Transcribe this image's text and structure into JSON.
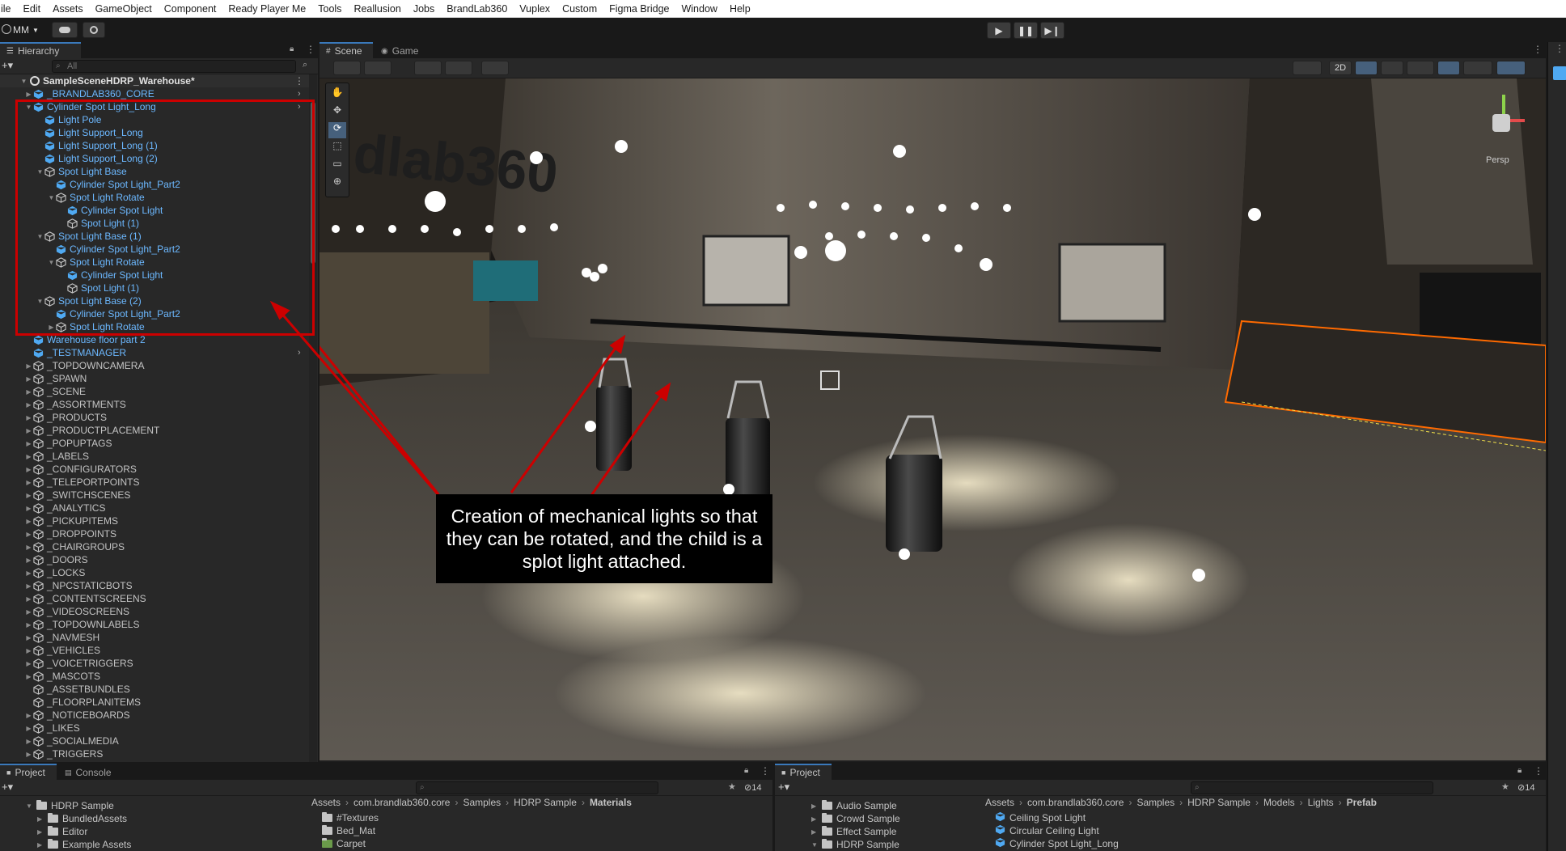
{
  "menu": [
    "ile",
    "Edit",
    "Assets",
    "GameObject",
    "Component",
    "Ready Player Me",
    "Tools",
    "Reallusion",
    "Jobs",
    "BrandLab360",
    "Vuplex",
    "Custom",
    "Figma Bridge",
    "Window",
    "Help"
  ],
  "toolbar": {
    "account": "MM"
  },
  "hierarchy": {
    "tab": "Hierarchy",
    "search_placeholder": "All",
    "scene": "SampleSceneHDRP_Warehouse*",
    "rows": [
      {
        "label": "_BRANDLAB360_CORE",
        "depth": 1,
        "arrow": "right",
        "icon": "prefab",
        "color": "blue",
        "chev": true
      },
      {
        "label": "Cylinder Spot Light_Long",
        "depth": 1,
        "arrow": "down",
        "icon": "prefab",
        "color": "blue",
        "chev": true
      },
      {
        "label": "Light Pole",
        "depth": 2,
        "arrow": "",
        "icon": "prefab",
        "color": "blue"
      },
      {
        "label": "Light Support_Long",
        "depth": 2,
        "arrow": "",
        "icon": "prefab",
        "color": "blue"
      },
      {
        "label": "Light Support_Long (1)",
        "depth": 2,
        "arrow": "",
        "icon": "prefab",
        "color": "blue"
      },
      {
        "label": "Light Support_Long (2)",
        "depth": 2,
        "arrow": "",
        "icon": "prefab",
        "color": "blue"
      },
      {
        "label": "Spot Light Base",
        "depth": 2,
        "arrow": "down",
        "icon": "plain",
        "color": "blue"
      },
      {
        "label": "Cylinder Spot Light_Part2",
        "depth": 3,
        "arrow": "",
        "icon": "prefab",
        "color": "blue"
      },
      {
        "label": "Spot Light Rotate",
        "depth": 3,
        "arrow": "down",
        "icon": "plain",
        "color": "blue"
      },
      {
        "label": "Cylinder Spot Light",
        "depth": 4,
        "arrow": "",
        "icon": "prefab",
        "color": "blue"
      },
      {
        "label": "Spot Light (1)",
        "depth": 4,
        "arrow": "",
        "icon": "plain",
        "color": "blue"
      },
      {
        "label": "Spot Light Base (1)",
        "depth": 2,
        "arrow": "down",
        "icon": "plain",
        "color": "blue"
      },
      {
        "label": "Cylinder Spot Light_Part2",
        "depth": 3,
        "arrow": "",
        "icon": "prefab",
        "color": "blue"
      },
      {
        "label": "Spot Light Rotate",
        "depth": 3,
        "arrow": "down",
        "icon": "plain",
        "color": "blue"
      },
      {
        "label": "Cylinder Spot Light",
        "depth": 4,
        "arrow": "",
        "icon": "prefab",
        "color": "blue"
      },
      {
        "label": "Spot Light (1)",
        "depth": 4,
        "arrow": "",
        "icon": "plain",
        "color": "blue"
      },
      {
        "label": "Spot Light Base (2)",
        "depth": 2,
        "arrow": "down",
        "icon": "plain",
        "color": "blue"
      },
      {
        "label": "Cylinder Spot Light_Part2",
        "depth": 3,
        "arrow": "",
        "icon": "prefab",
        "color": "blue"
      },
      {
        "label": "Spot Light Rotate",
        "depth": 3,
        "arrow": "right",
        "icon": "plain",
        "color": "blue"
      },
      {
        "label": "Warehouse floor part 2",
        "depth": 1,
        "arrow": "",
        "icon": "prefab",
        "color": "blue"
      },
      {
        "label": "_TESTMANAGER",
        "depth": 1,
        "arrow": "",
        "icon": "prefab",
        "color": "blue",
        "chev": true
      },
      {
        "label": "_TOPDOWNCAMERA",
        "depth": 1,
        "arrow": "right",
        "icon": "plain",
        "color": "grey"
      },
      {
        "label": "_SPAWN",
        "depth": 1,
        "arrow": "right",
        "icon": "plain",
        "color": "grey"
      },
      {
        "label": "_SCENE",
        "depth": 1,
        "arrow": "right",
        "icon": "plain",
        "color": "grey"
      },
      {
        "label": "_ASSORTMENTS",
        "depth": 1,
        "arrow": "right",
        "icon": "plain",
        "color": "grey"
      },
      {
        "label": "_PRODUCTS",
        "depth": 1,
        "arrow": "right",
        "icon": "plain",
        "color": "grey"
      },
      {
        "label": "_PRODUCTPLACEMENT",
        "depth": 1,
        "arrow": "right",
        "icon": "plain",
        "color": "grey"
      },
      {
        "label": "_POPUPTAGS",
        "depth": 1,
        "arrow": "right",
        "icon": "plain",
        "color": "grey"
      },
      {
        "label": "_LABELS",
        "depth": 1,
        "arrow": "right",
        "icon": "plain",
        "color": "grey"
      },
      {
        "label": "_CONFIGURATORS",
        "depth": 1,
        "arrow": "right",
        "icon": "plain",
        "color": "grey"
      },
      {
        "label": "_TELEPORTPOINTS",
        "depth": 1,
        "arrow": "right",
        "icon": "plain",
        "color": "grey"
      },
      {
        "label": "_SWITCHSCENES",
        "depth": 1,
        "arrow": "right",
        "icon": "plain",
        "color": "grey"
      },
      {
        "label": "_ANALYTICS",
        "depth": 1,
        "arrow": "right",
        "icon": "plain",
        "color": "grey"
      },
      {
        "label": "_PICKUPITEMS",
        "depth": 1,
        "arrow": "right",
        "icon": "plain",
        "color": "grey"
      },
      {
        "label": "_DROPPOINTS",
        "depth": 1,
        "arrow": "right",
        "icon": "plain",
        "color": "grey"
      },
      {
        "label": "_CHAIRGROUPS",
        "depth": 1,
        "arrow": "right",
        "icon": "plain",
        "color": "grey"
      },
      {
        "label": "_DOORS",
        "depth": 1,
        "arrow": "right",
        "icon": "plain",
        "color": "grey"
      },
      {
        "label": "_LOCKS",
        "depth": 1,
        "arrow": "right",
        "icon": "plain",
        "color": "grey"
      },
      {
        "label": "_NPCSTATICBOTS",
        "depth": 1,
        "arrow": "right",
        "icon": "plain",
        "color": "grey"
      },
      {
        "label": "_CONTENTSCREENS",
        "depth": 1,
        "arrow": "right",
        "icon": "plain",
        "color": "grey"
      },
      {
        "label": "_VIDEOSCREENS",
        "depth": 1,
        "arrow": "right",
        "icon": "plain",
        "color": "grey"
      },
      {
        "label": "_TOPDOWNLABELS",
        "depth": 1,
        "arrow": "right",
        "icon": "plain",
        "color": "grey"
      },
      {
        "label": "_NAVMESH",
        "depth": 1,
        "arrow": "right",
        "icon": "plain",
        "color": "grey"
      },
      {
        "label": "_VEHICLES",
        "depth": 1,
        "arrow": "right",
        "icon": "plain",
        "color": "grey"
      },
      {
        "label": "_VOICETRIGGERS",
        "depth": 1,
        "arrow": "right",
        "icon": "plain",
        "color": "grey"
      },
      {
        "label": "_MASCOTS",
        "depth": 1,
        "arrow": "right",
        "icon": "plain",
        "color": "grey"
      },
      {
        "label": "_ASSETBUNDLES",
        "depth": 1,
        "arrow": "",
        "icon": "plain",
        "color": "grey"
      },
      {
        "label": "_FLOORPLANITEMS",
        "depth": 1,
        "arrow": "",
        "icon": "plain",
        "color": "grey"
      },
      {
        "label": "_NOTICEBOARDS",
        "depth": 1,
        "arrow": "right",
        "icon": "plain",
        "color": "grey"
      },
      {
        "label": "_LIKES",
        "depth": 1,
        "arrow": "right",
        "icon": "plain",
        "color": "grey"
      },
      {
        "label": "_SOCIALMEDIA",
        "depth": 1,
        "arrow": "right",
        "icon": "plain",
        "color": "grey"
      },
      {
        "label": "_TRIGGERS",
        "depth": 1,
        "arrow": "right",
        "icon": "plain",
        "color": "grey"
      }
    ]
  },
  "scene": {
    "tab_scene": "Scene",
    "tab_game": "Game",
    "btn_2d": "2D",
    "persp": "Persp",
    "sign_text": "dlab360",
    "callout": "Creation of mechanical lights so that they can be rotated, and the child is a splot light attached."
  },
  "project_left": {
    "tab_project": "Project",
    "tab_console": "Console",
    "badge": "14",
    "tree": [
      "HDRP Sample",
      "BundledAssets",
      "Editor",
      "Example Assets"
    ],
    "breadcrumb": [
      "Assets",
      "com.brandlab360.core",
      "Samples",
      "HDRP Sample",
      "Materials"
    ],
    "items": [
      "#Textures",
      "Bed_Mat",
      "Carpet"
    ]
  },
  "project_right": {
    "tab_project": "Project",
    "badge": "14",
    "tree": [
      "Audio Sample",
      "Crowd Sample",
      "Effect Sample",
      "HDRP Sample"
    ],
    "breadcrumb": [
      "Assets",
      "com.brandlab360.core",
      "Samples",
      "HDRP Sample",
      "Models",
      "Lights",
      "Prefab"
    ],
    "items": [
      "Ceiling Spot Light",
      "Circular Ceiling Light",
      "Cylinder Spot Light_Long"
    ]
  },
  "colors": {
    "accent": "#3a79bb",
    "prefab_blue": "#6cb8ff",
    "annotation_red": "#cc0000",
    "selection_orange": "#ff6a00"
  }
}
